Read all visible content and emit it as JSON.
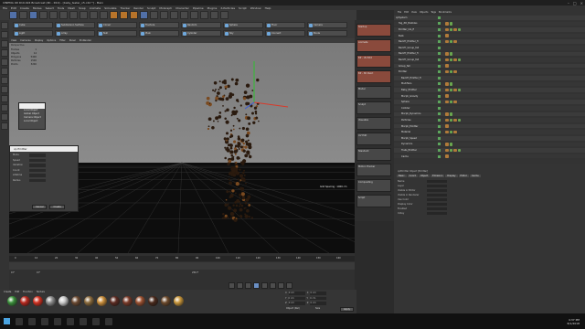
{
  "window": {
    "title": "CINEMA 4D R19.024 Broadcast (RC - R19) - [baby_tester_v5.c4d *] - Main"
  },
  "menubar": [
    "File",
    "Edit",
    "Create",
    "Modes",
    "Select",
    "Tools",
    "Mesh",
    "Snap",
    "Animate",
    "Simulate",
    "Tracker",
    "Render",
    "Sculpt",
    "MoGraph",
    "Character",
    "Pipeline",
    "Plugins",
    "X-Particles",
    "Script",
    "Window",
    "Help"
  ],
  "object_buttons": [
    "Cube",
    "Subdivision Surface",
    "Cloner",
    "Fracture",
    "Random",
    "Sphere",
    "Floor",
    "Camera",
    "Light",
    "Array",
    "Null",
    "Plain",
    "Cylinder",
    "Sky",
    "Connect",
    "Boole"
  ],
  "viewport_menu": [
    "View",
    "Cameras",
    "Display",
    "Options",
    "Filter",
    "Panel",
    "ProRender"
  ],
  "viewport": {
    "label": "Perspective",
    "grid_spacing": "Grid Spacing : 1000 cm",
    "hud": [
      [
        "Frames",
        "1"
      ],
      [
        "Objects",
        "14"
      ],
      [
        "Polygons",
        "5400"
      ],
      [
        "Particles",
        "1500"
      ],
      [
        "Points",
        "3200"
      ]
    ]
  },
  "popup_menu": [
    "Local Object",
    "Global Object",
    "Camera Object",
    "Local Object"
  ],
  "dialog": {
    "title": "xp Emitter",
    "fields": [
      "Mode",
      "Speed",
      "Variation",
      "Count",
      "Lifetime",
      "Radius"
    ],
    "buttons": [
      "Cancel",
      "Create"
    ]
  },
  "timeline": {
    "ticks": [
      "0",
      "10",
      "20",
      "30",
      "40",
      "50",
      "60",
      "70",
      "80",
      "90",
      "100",
      "110",
      "120",
      "130",
      "140",
      "150",
      "160"
    ],
    "start": "0 F",
    "end": "250 F",
    "current": "0 F"
  },
  "material_menu": [
    "Create",
    "Edit",
    "Function",
    "Texture"
  ],
  "materials": [
    "#3b8f3b",
    "#b8281e",
    "#d03020",
    "#8d8d8d",
    "#c9c9c9",
    "#6b4a32",
    "#8a6a3c",
    "#c98d3a",
    "#5c2b22",
    "#7a3a28",
    "#9a5030",
    "#4a2a1c",
    "#6c4a2c",
    "#c7953a"
  ],
  "coord": {
    "rows": [
      [
        "X",
        "0 cm",
        "X",
        "0 cm"
      ],
      [
        "Y",
        "0 cm",
        "Y",
        "0 cm"
      ],
      [
        "Z",
        "0 cm",
        "Z",
        "0 cm"
      ]
    ],
    "mode": "Object (Rel)",
    "size": "Size",
    "apply": "Apply"
  },
  "layouts": [
    "Startup",
    "Animate",
    "BP - UV Edit",
    "BP - 3D Paint",
    "Model",
    "Sculpt",
    "Visualize",
    "UV Edit",
    "Standard",
    "Motion Tracker",
    "Compositing",
    "Script"
  ],
  "objmgr_menu": [
    "File",
    "Edit",
    "View",
    "Objects",
    "Tags",
    "Bookmarks"
  ],
  "objects": [
    "xpSystem",
    "Tag_ZD_Bubbles",
    "Emitter_UG_fl",
    "Bulb",
    "BackTr_Emitter_fl",
    "BackTr_Group_fall",
    "BackTr_Emitter_fl",
    "BackTr_Group_fall",
    "Group_fall",
    "Emitter",
    "BackTr_Emitter_fl",
    "Modifiers",
    "Baby_Emitter",
    "Morph_Gravity",
    "Sphere",
    "Collider",
    "Morph_Dynamics",
    "Particles",
    "Morph_Emitter",
    "Material",
    "Morph_Speed",
    "Dynamics",
    "Trails_Emitter",
    "Cache"
  ],
  "attr": {
    "tabs": [
      "Basic",
      "Coord",
      "Object",
      "Emission",
      "Display",
      "Editor",
      "Cache"
    ],
    "rows": [
      "Name",
      "Layer",
      "Visible in Editor",
      "Visible in Renderer",
      "Use Color",
      "Display Color",
      "Enabled",
      "X-Ray"
    ],
    "header": "xpEmitter Object [Emitter]"
  },
  "taskbar": {
    "time": "4:37 PM",
    "date": "8/1/2018"
  }
}
